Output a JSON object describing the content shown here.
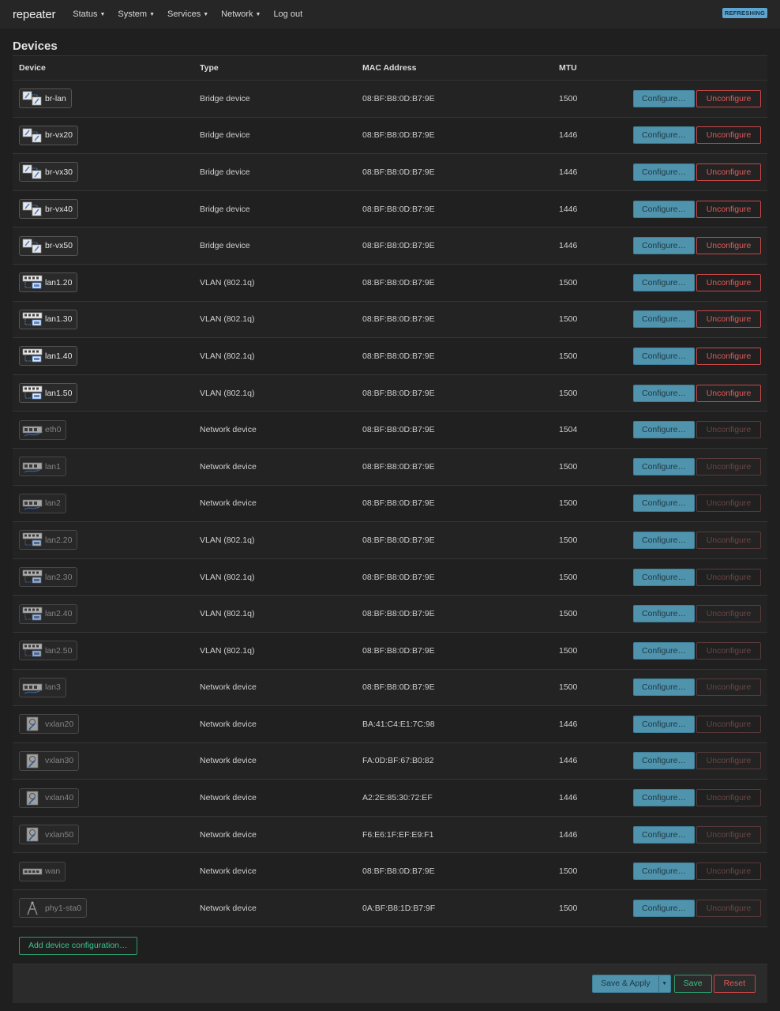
{
  "header": {
    "brand": "repeater",
    "nav": [
      "Status",
      "System",
      "Services",
      "Network",
      "Log out"
    ],
    "badge": "REFRESHING"
  },
  "page": {
    "title": "Devices"
  },
  "table": {
    "columns": [
      "Device",
      "Type",
      "MAC Address",
      "MTU",
      ""
    ],
    "configure_label": "Configure…",
    "unconfigure_label": "Unconfigure",
    "rows": [
      {
        "name": "br-lan",
        "type": "Bridge device",
        "mac": "08:BF:B8:0D:B7:9E",
        "mtu": "1500",
        "icon": "bridge-icon",
        "configured": true
      },
      {
        "name": "br-vx20",
        "type": "Bridge device",
        "mac": "08:BF:B8:0D:B7:9E",
        "mtu": "1446",
        "icon": "bridge-icon",
        "configured": true
      },
      {
        "name": "br-vx30",
        "type": "Bridge device",
        "mac": "08:BF:B8:0D:B7:9E",
        "mtu": "1446",
        "icon": "bridge-icon",
        "configured": true
      },
      {
        "name": "br-vx40",
        "type": "Bridge device",
        "mac": "08:BF:B8:0D:B7:9E",
        "mtu": "1446",
        "icon": "bridge-icon",
        "configured": true
      },
      {
        "name": "br-vx50",
        "type": "Bridge device",
        "mac": "08:BF:B8:0D:B7:9E",
        "mtu": "1446",
        "icon": "bridge-icon",
        "configured": true
      },
      {
        "name": "lan1.20",
        "type": "VLAN (802.1q)",
        "mac": "08:BF:B8:0D:B7:9E",
        "mtu": "1500",
        "icon": "vlan-icon",
        "configured": true
      },
      {
        "name": "lan1.30",
        "type": "VLAN (802.1q)",
        "mac": "08:BF:B8:0D:B7:9E",
        "mtu": "1500",
        "icon": "vlan-icon",
        "configured": true
      },
      {
        "name": "lan1.40",
        "type": "VLAN (802.1q)",
        "mac": "08:BF:B8:0D:B7:9E",
        "mtu": "1500",
        "icon": "vlan-icon",
        "configured": true
      },
      {
        "name": "lan1.50",
        "type": "VLAN (802.1q)",
        "mac": "08:BF:B8:0D:B7:9E",
        "mtu": "1500",
        "icon": "vlan-icon",
        "configured": true
      },
      {
        "name": "eth0",
        "type": "Network device",
        "mac": "08:BF:B8:0D:B7:9E",
        "mtu": "1504",
        "icon": "ethernet-port-icon",
        "configured": false
      },
      {
        "name": "lan1",
        "type": "Network device",
        "mac": "08:BF:B8:0D:B7:9E",
        "mtu": "1500",
        "icon": "ethernet-port-icon",
        "configured": false
      },
      {
        "name": "lan2",
        "type": "Network device",
        "mac": "08:BF:B8:0D:B7:9E",
        "mtu": "1500",
        "icon": "ethernet-port-icon",
        "configured": false
      },
      {
        "name": "lan2.20",
        "type": "VLAN (802.1q)",
        "mac": "08:BF:B8:0D:B7:9E",
        "mtu": "1500",
        "icon": "vlan-icon",
        "configured": false
      },
      {
        "name": "lan2.30",
        "type": "VLAN (802.1q)",
        "mac": "08:BF:B8:0D:B7:9E",
        "mtu": "1500",
        "icon": "vlan-icon",
        "configured": false
      },
      {
        "name": "lan2.40",
        "type": "VLAN (802.1q)",
        "mac": "08:BF:B8:0D:B7:9E",
        "mtu": "1500",
        "icon": "vlan-icon",
        "configured": false
      },
      {
        "name": "lan2.50",
        "type": "VLAN (802.1q)",
        "mac": "08:BF:B8:0D:B7:9E",
        "mtu": "1500",
        "icon": "vlan-icon",
        "configured": false
      },
      {
        "name": "lan3",
        "type": "Network device",
        "mac": "08:BF:B8:0D:B7:9E",
        "mtu": "1500",
        "icon": "ethernet-port-icon",
        "configured": false
      },
      {
        "name": "vxlan20",
        "type": "Network device",
        "mac": "BA:41:C4:E1:7C:98",
        "mtu": "1446",
        "icon": "tunnel-icon",
        "configured": false
      },
      {
        "name": "vxlan30",
        "type": "Network device",
        "mac": "FA:0D:BF:67:B0:82",
        "mtu": "1446",
        "icon": "tunnel-icon",
        "configured": false
      },
      {
        "name": "vxlan40",
        "type": "Network device",
        "mac": "A2:2E:85:30:72:EF",
        "mtu": "1446",
        "icon": "tunnel-icon",
        "configured": false
      },
      {
        "name": "vxlan50",
        "type": "Network device",
        "mac": "F6:E6:1F:EF:E9:F1",
        "mtu": "1446",
        "icon": "tunnel-icon",
        "configured": false
      },
      {
        "name": "wan",
        "type": "Network device",
        "mac": "08:BF:B8:0D:B7:9E",
        "mtu": "1500",
        "icon": "switch-ports-icon",
        "configured": false
      },
      {
        "name": "phy1-sta0",
        "type": "Network device",
        "mac": "0A:BF:B8:1D:B7:9F",
        "mtu": "1500",
        "icon": "wifi-antenna-icon",
        "configured": false
      }
    ]
  },
  "add_button": "Add device configuration…",
  "footer": {
    "save_apply": "Save & Apply",
    "save": "Save",
    "reset": "Reset"
  }
}
